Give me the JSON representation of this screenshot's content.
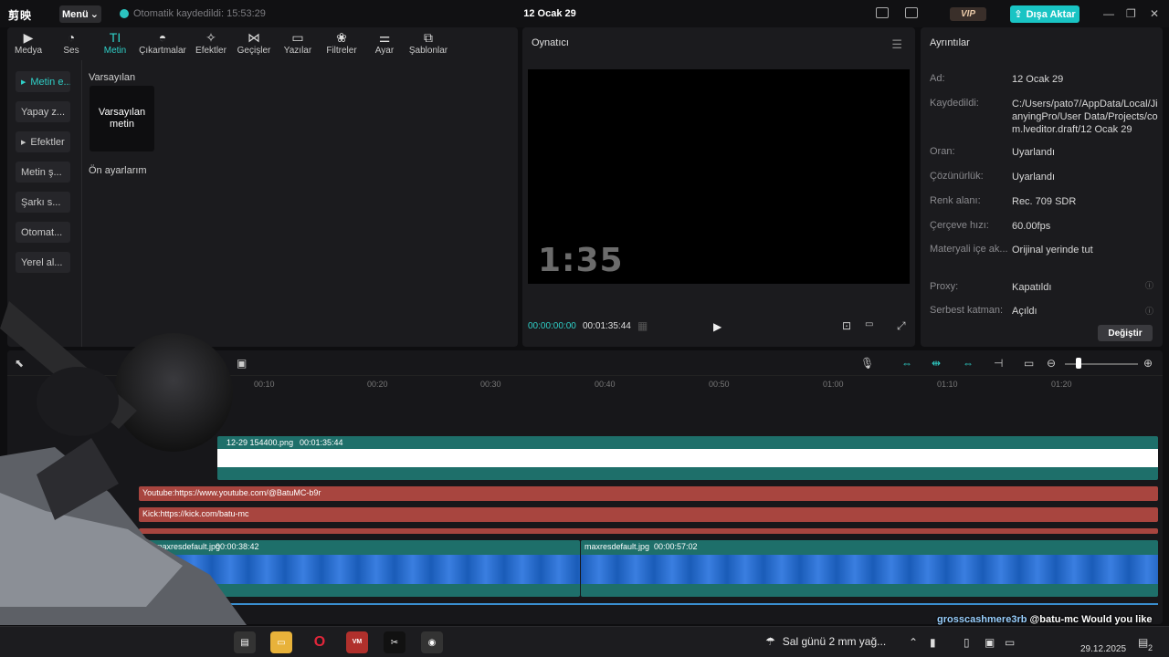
{
  "titlebar": {
    "logo": "剪映",
    "menu": "Menü",
    "autosave": "Otomatik kaydedildi: 15:53:29",
    "project_title": "12 Ocak 29",
    "vip": "VIP",
    "export": "Dışa Aktar"
  },
  "tabs": [
    {
      "label": "Medya",
      "icon": "▶"
    },
    {
      "label": "Ses",
      "icon": "◔"
    },
    {
      "label": "Metin",
      "icon": "TI"
    },
    {
      "label": "Çıkartmalar",
      "icon": "◓"
    },
    {
      "label": "Efektler",
      "icon": "✧"
    },
    {
      "label": "Geçişler",
      "icon": "⋈"
    },
    {
      "label": "Yazılar",
      "icon": "▭"
    },
    {
      "label": "Filtreler",
      "icon": "❀"
    },
    {
      "label": "Ayar",
      "icon": "⚌"
    },
    {
      "label": "Şablonlar",
      "icon": "⧉"
    }
  ],
  "sidebar": {
    "items": [
      {
        "label": "Metin e..."
      },
      {
        "label": "Yapay z..."
      },
      {
        "label": "Efektler"
      },
      {
        "label": "Metin ş..."
      },
      {
        "label": "Şarkı s..."
      },
      {
        "label": "Otomat..."
      },
      {
        "label": "Yerel al..."
      }
    ]
  },
  "library": {
    "section_default": "Varsayılan",
    "default_card": "Varsayılan metin",
    "section_presets": "Ön ayarlarım"
  },
  "player": {
    "title": "Oynatıcı",
    "overlay_time": "1:35",
    "current_time": "00:00:00:00",
    "duration": "00:01:35:44"
  },
  "details": {
    "title": "Ayrıntılar",
    "rows": [
      {
        "key": "Ad:",
        "value": "12 Ocak 29"
      },
      {
        "key": "Kaydedildi:",
        "value": "C:/Users/pato7/AppData/Local/JianyingPro/User Data/Projects/com.lveditor.draft/12 Ocak 29"
      },
      {
        "key": "Oran:",
        "value": "Uyarlandı"
      },
      {
        "key": "Çözünürlük:",
        "value": "Uyarlandı"
      },
      {
        "key": "Renk alanı:",
        "value": "Rec. 709 SDR"
      },
      {
        "key": "Çerçeve hızı:",
        "value": "60.00fps"
      },
      {
        "key": "Materyali içe ak...",
        "value": "Orijinal yerinde tut"
      },
      {
        "key": "Proxy:",
        "value": "Kapatıldı"
      },
      {
        "key": "Serbest katman:",
        "value": "Açıldı"
      }
    ],
    "change_button": "Değiştir"
  },
  "timeline": {
    "ruler": [
      "00:10",
      "00:20",
      "00:30",
      "00:40",
      "00:50",
      "01:00",
      "01:10",
      "01:20"
    ],
    "main_clip": {
      "name": "12-29 154400.png",
      "duration": "00:01:35:44"
    },
    "text_clips": [
      {
        "text": "Youtube:https://www.youtube.com/@BatuMC-b9r"
      },
      {
        "text": "Kick:https://kick.com/batu-mc"
      }
    ],
    "image_clips": [
      {
        "name": "maxresdefault.jpg",
        "duration": "00:00:38:42"
      },
      {
        "name": "maxresdefault.jpg",
        "duration": "00:00:57:02"
      }
    ]
  },
  "taskbar": {
    "weather": "Sal günü 2 mm yağ...",
    "date": "29.12.2025",
    "notifications": "2"
  },
  "chat": {
    "user1": "grosscashmere3rb",
    "msg": "@batu-mc Would you like many viewers? Come in - viewsbot.com"
  },
  "colors": {
    "accent": "#2fd0c8",
    "export": "#19c4c4",
    "main_clip": "#1e6f6a",
    "text_clip": "#a8453f",
    "image_clip": "#1a5cb8"
  }
}
